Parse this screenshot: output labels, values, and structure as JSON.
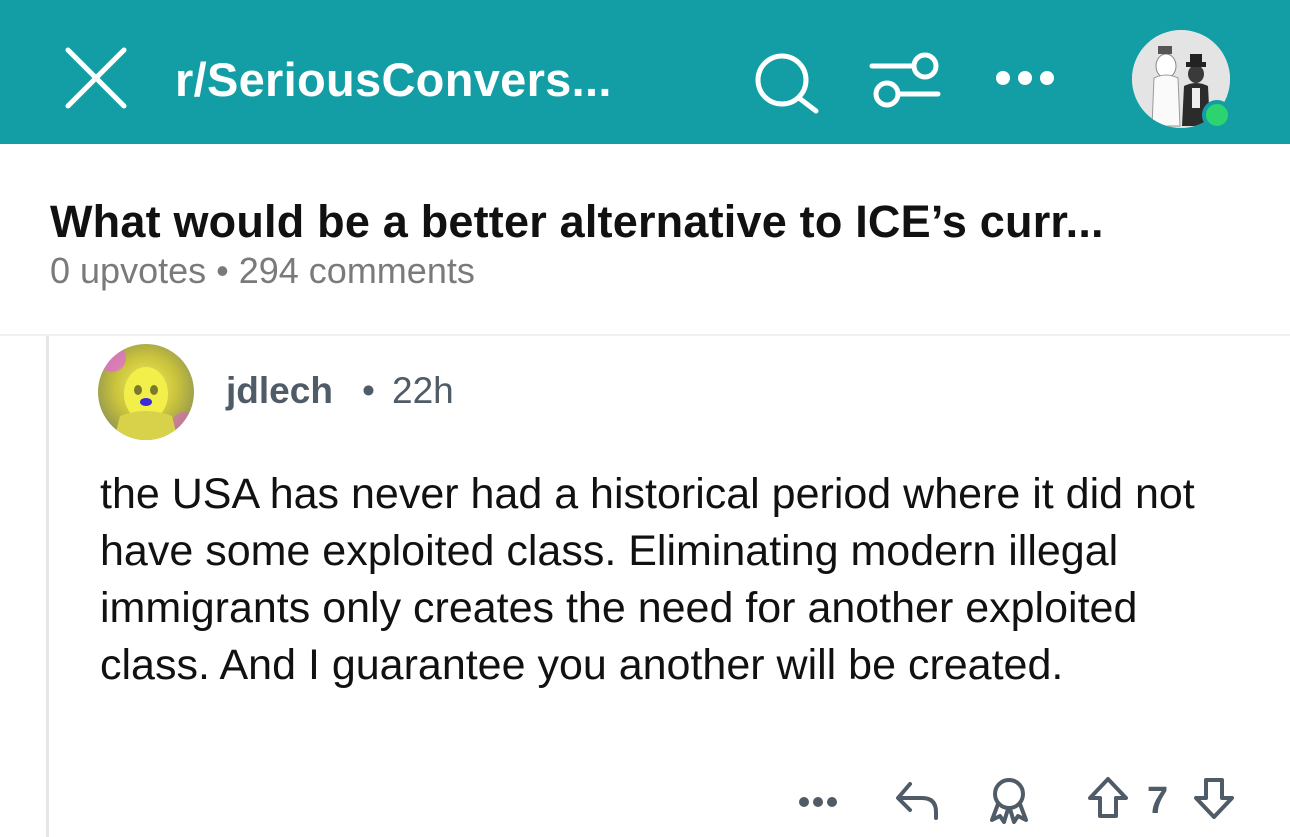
{
  "app_bar": {
    "subreddit": "r/SeriousConvers...",
    "background_color": "#139ea6",
    "icons": [
      "close-icon",
      "search-icon",
      "filter-icon",
      "more-options-icon"
    ],
    "status_color": "#2dd36f"
  },
  "post": {
    "title": "What would be a better alternative to ICE’s curr...",
    "upvotes": "0 upvotes",
    "separator": "•",
    "comments": "294 comments"
  },
  "comment": {
    "author": "jdlech",
    "separator": "•",
    "age": "22h",
    "body": "the USA has never had a historical period where it did not have some exploited class.  Eliminating modern illegal immigrants only creates the need for another exploited class. And I guarantee you another will be created.",
    "vote_count": "7",
    "actions": [
      "more-icon",
      "reply-icon",
      "award-icon",
      "upvote-icon",
      "downvote-icon"
    ]
  }
}
